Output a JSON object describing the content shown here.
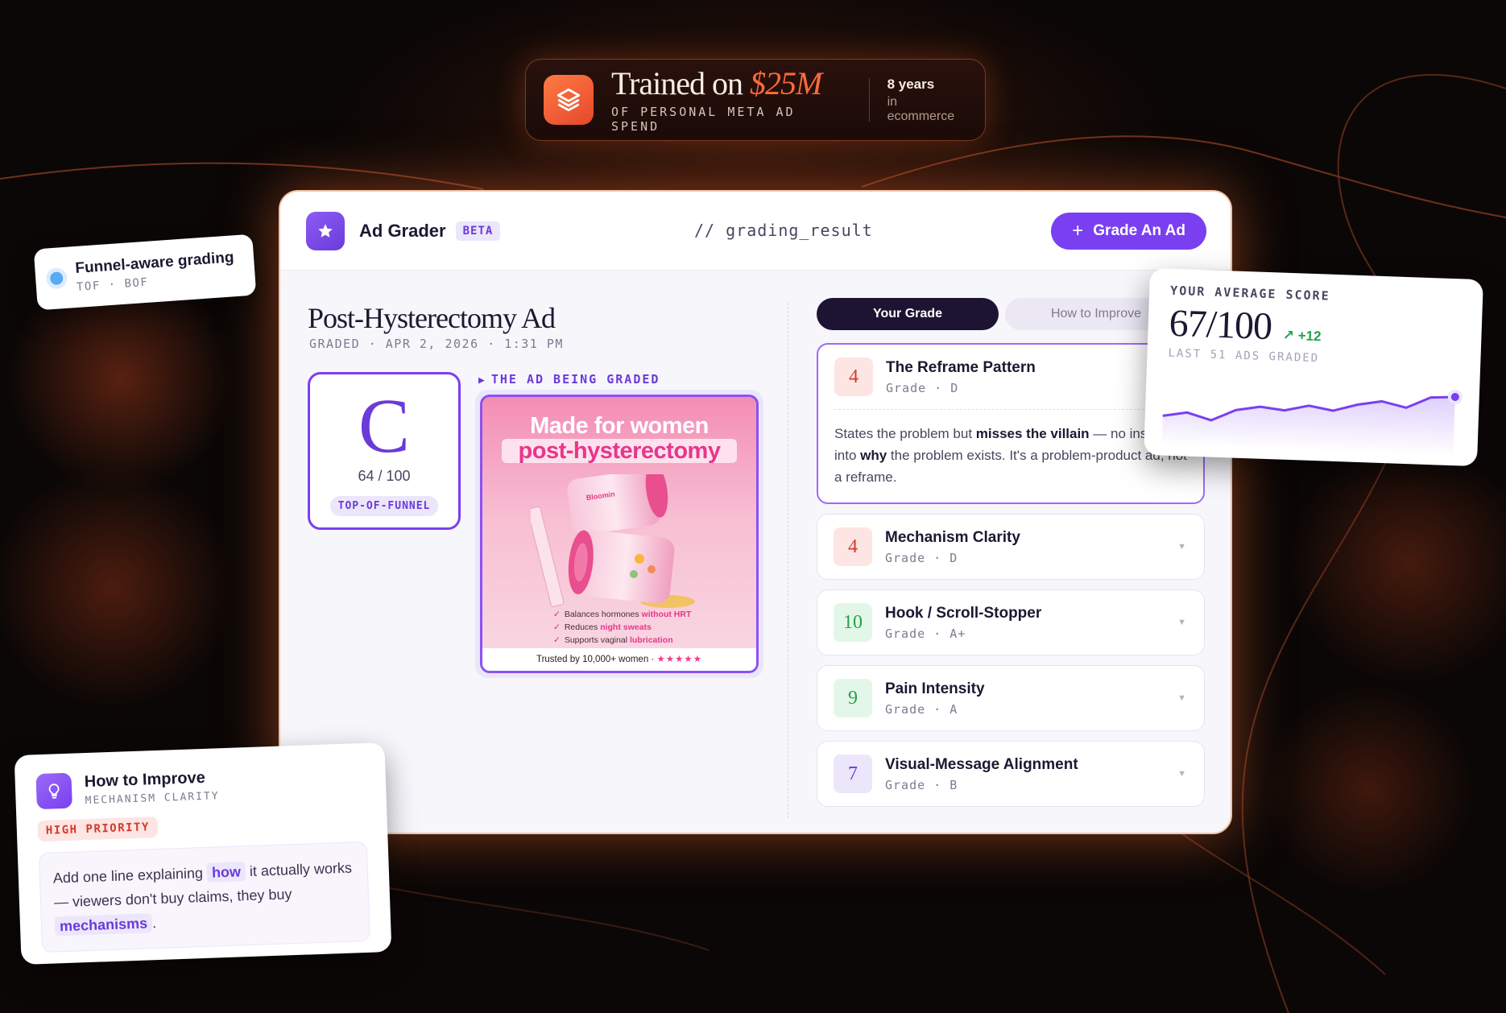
{
  "trained_badge": {
    "title_prefix": "Trained on",
    "amount": "$25M",
    "subtitle": "OF PERSONAL META AD SPEND",
    "years": "8 years",
    "years_sub": "in ecommerce"
  },
  "header": {
    "app_name": "Ad Grader",
    "beta_label": "BETA",
    "code_label": "// grading_result",
    "grade_button_label": "Grade An Ad"
  },
  "ad": {
    "title": "Post-Hysterectomy Ad",
    "graded_meta": "GRADED · APR 2, 2026 · 1:31 PM",
    "grade_letter": "C",
    "grade_score": "64 / 100",
    "funnel_label": "TOP-OF-FUNNEL",
    "image_label": "THE AD BEING GRADED",
    "creative": {
      "headline_1": "Made for women",
      "headline_2": "post-hysterectomy",
      "brand": "Bloomin",
      "bullet_1_a": "Balances hormones",
      "bullet_1_b": "without HRT",
      "bullet_2_a": "Reduces",
      "bullet_2_b": "night sweats",
      "bullet_3_a": "Supports vaginal",
      "bullet_3_b": "lubrication",
      "footer": "Trusted by 10,000+ women ·",
      "stars": "★★★★★"
    }
  },
  "tabs": {
    "your_grade": "Your Grade",
    "how_to_improve": "How to Improve"
  },
  "criteria": [
    {
      "score": "4",
      "name": "The Reframe Pattern",
      "grade": "Grade · D",
      "desc_1": "States the problem but ",
      "desc_b1": "misses the villain",
      "desc_2": " — no insight into ",
      "desc_b2": "why",
      "desc_3": " the problem exists. It's a problem-product ad, not a reframe."
    },
    {
      "score": "4",
      "name": "Mechanism Clarity",
      "grade": "Grade · D"
    },
    {
      "score": "10",
      "name": "Hook / Scroll-Stopper",
      "grade": "Grade · A+"
    },
    {
      "score": "9",
      "name": "Pain Intensity",
      "grade": "Grade · A"
    },
    {
      "score": "7",
      "name": "Visual-Message Alignment",
      "grade": "Grade · B"
    }
  ],
  "funnel_card": {
    "title": "Funnel-aware grading",
    "sub": "TOF · BOF"
  },
  "score_card": {
    "label": "YOUR AVERAGE SCORE",
    "value": "67/100",
    "delta": "↗ +12",
    "sub": "LAST 51 ADS GRADED",
    "trend": [
      52,
      55,
      50,
      58,
      61,
      59,
      63,
      60,
      65,
      68,
      64,
      72,
      73
    ]
  },
  "improve_card": {
    "title": "How to Improve",
    "sub": "MECHANISM CLARITY",
    "priority": "HIGH PRIORITY",
    "text_1": "Add one line explaining ",
    "kw_1": "how",
    "text_2": " it actually works — viewers don't buy claims, they buy ",
    "kw_2": "mechanisms",
    "text_3": "."
  },
  "colors": {
    "accent": "#7a3ff0",
    "brand_orange": "#ff6a3a",
    "grade_red": "#d33a2c",
    "grade_green": "#23a04c"
  },
  "icons": {
    "trained": "layers-icon",
    "logo": "star-icon",
    "funnel": "dot-icon",
    "improve": "lightbulb-icon",
    "chevron": "chevron-down-icon"
  }
}
